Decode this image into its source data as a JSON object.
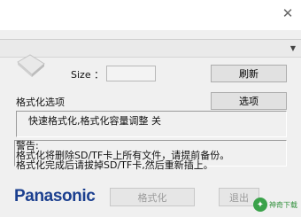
{
  "window": {
    "close_icon": "close-icon"
  },
  "drive": {
    "selected": "",
    "arrow_icon": "chevron-down-icon"
  },
  "size": {
    "label": "Size ：",
    "value": ""
  },
  "buttons": {
    "refresh": "刷新",
    "options": "选项",
    "format": "格式化",
    "exit": "退出"
  },
  "format_options": {
    "label": "格式化选项",
    "value": "快速格式化,格式化容量调整 关"
  },
  "warning": {
    "title": "警告:",
    "line1": "格式化将删除SD/TF卡上所有文件，请提前备份。",
    "line2": "格式化完成后请拔掉SD/TF卡,然后重新插上。"
  },
  "brand": {
    "logo": "Panasonic",
    "color": "#1b3f8f"
  },
  "watermark": {
    "text": "神奇下载"
  }
}
